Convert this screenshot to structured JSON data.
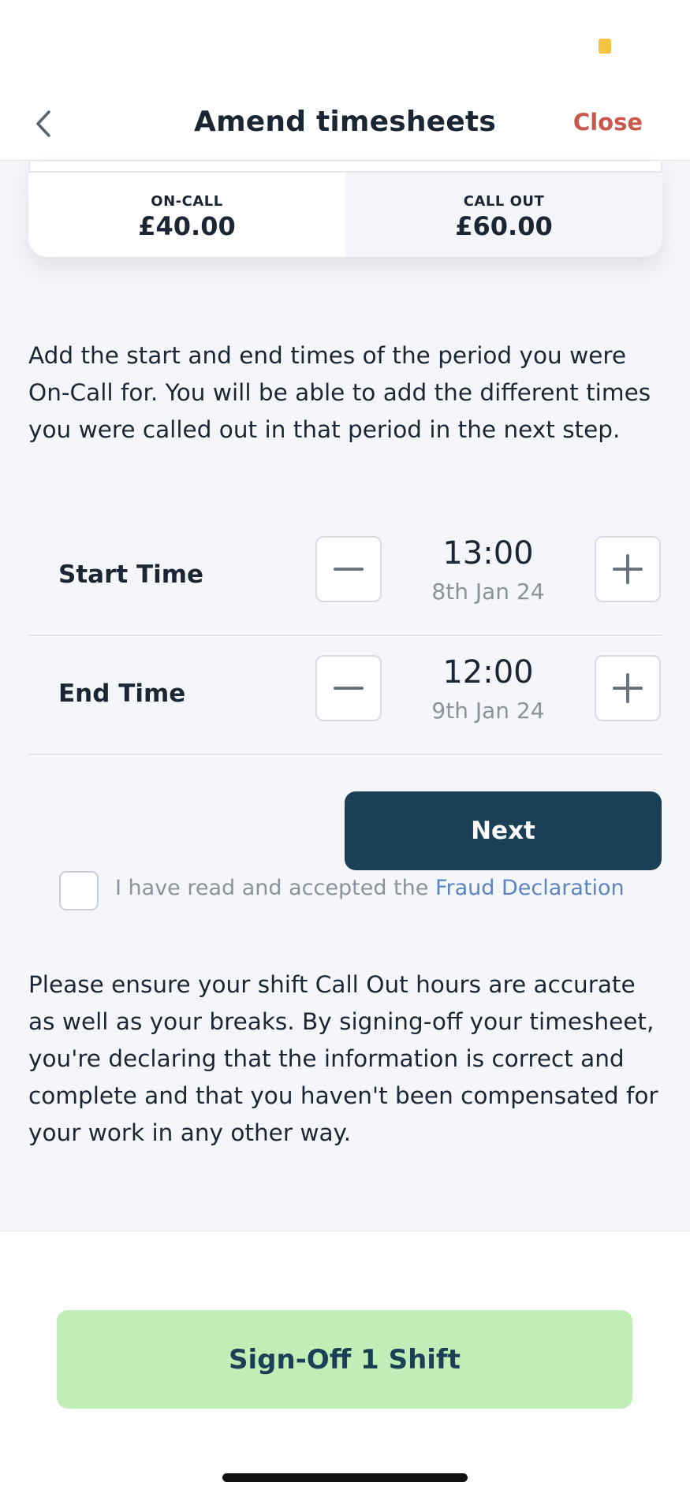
{
  "header": {
    "title": "Amend timesheets",
    "close_label": "Close",
    "back_icon": "chevron-left-icon"
  },
  "rates": {
    "on_call": {
      "label": "ON-CALL",
      "value": "£40.00"
    },
    "call_out": {
      "label": "CALL OUT",
      "value": "£60.00"
    }
  },
  "intro": "Add the start and end times of the period you were On-Call for. You will be able to add the different times you were called out in that period in the next step.",
  "times": {
    "start": {
      "label": "Start Time",
      "time": "13:00",
      "date": "8th Jan 24"
    },
    "end": {
      "label": "End Time",
      "time": "12:00",
      "date": "9th Jan 24"
    }
  },
  "next_label": "Next",
  "fraud": {
    "text": "I have read and accepted the",
    "link": "Fraud Declaration",
    "checked": false
  },
  "declaration": "Please ensure your shift Call Out hours are accurate as well as your breaks. By signing-off your timesheet, you're declaring that the information is correct and complete and that you haven't been compensated for your work in any other way.",
  "signoff_label": "Sign-Off 1 Shift",
  "colors": {
    "accent": "#c9574a",
    "primary": "#1c3f58",
    "signoff_bg": "#bfefb6",
    "link": "#5b84c2"
  }
}
